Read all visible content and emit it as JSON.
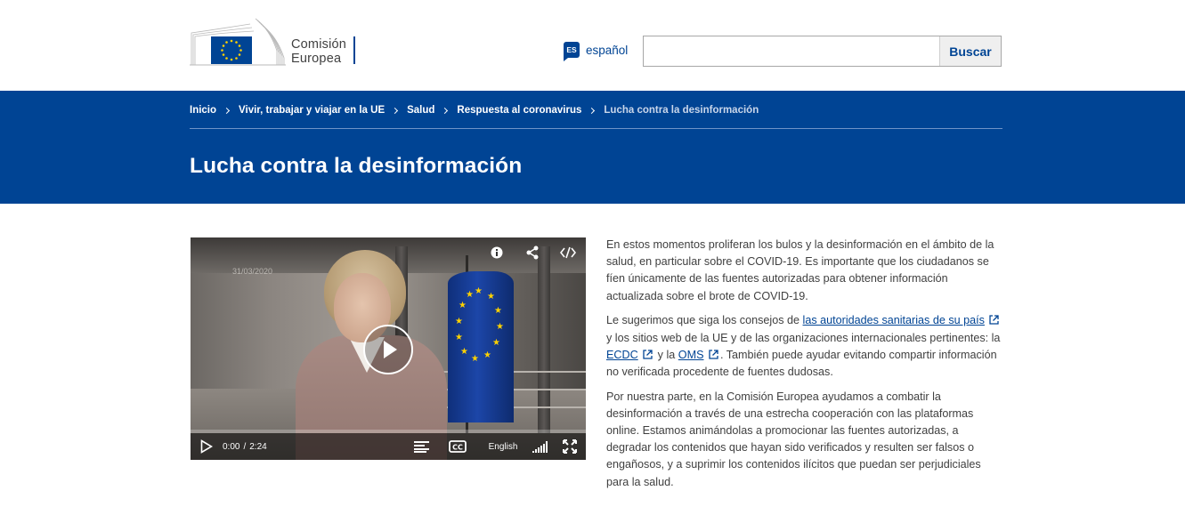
{
  "header": {
    "logo_line1": "Comisión",
    "logo_line2": "Europea",
    "lang_code": "ES",
    "lang_label": "español",
    "search_placeholder": "",
    "search_button": "Buscar"
  },
  "breadcrumb": [
    {
      "label": "Inicio"
    },
    {
      "label": "Vivir, trabajar y viajar en la UE"
    },
    {
      "label": "Salud"
    },
    {
      "label": "Respuesta al coronavirus"
    },
    {
      "label": "Lucha contra la desinformación"
    }
  ],
  "page_title": "Lucha contra la desinformación",
  "video": {
    "overlay_date": "31/03/2020",
    "icons": [
      "info-icon",
      "share-icon",
      "embed-code-icon"
    ],
    "current_time": "0:00",
    "time_separator": "/",
    "duration": "2:24",
    "language": "English",
    "progress": 0.0
  },
  "article": {
    "p1": "En estos momentos proliferan los bulos y la desinformación en el ámbito de la salud, en particular sobre el COVID-19. Es importante que los ciudadanos se fíen únicamente de las fuentes autorizadas para obtener información actualizada sobre el brote de COVID-19.",
    "p2_before": "Le sugerimos que siga los consejos de ",
    "p2_link1": "las autoridades sanitarias de su país",
    "p2_mid1": " y los sitios web de la UE y de las organizaciones internacionales pertinentes: la ",
    "p2_link2": "ECDC",
    "p2_mid2": " y la ",
    "p2_link3": "OMS",
    "p2_after": ". También puede ayudar evitando compartir información no verificada procedente de fuentes dudosas.",
    "p3": "Por nuestra parte, en la Comisión Europea ayudamos a combatir la desinformación a través de una estrecha cooperación con las plataformas online. Estamos animándolas a promocionar las fuentes autorizadas, a degradar los contenidos que hayan sido verificados y resulten ser falsos o engañosos, y a suprimir los contenidos ilícitos que puedan ser perjudiciales para la salud."
  },
  "colors": {
    "brand_blue": "#004494",
    "eu_yellow": "#ffd200"
  }
}
